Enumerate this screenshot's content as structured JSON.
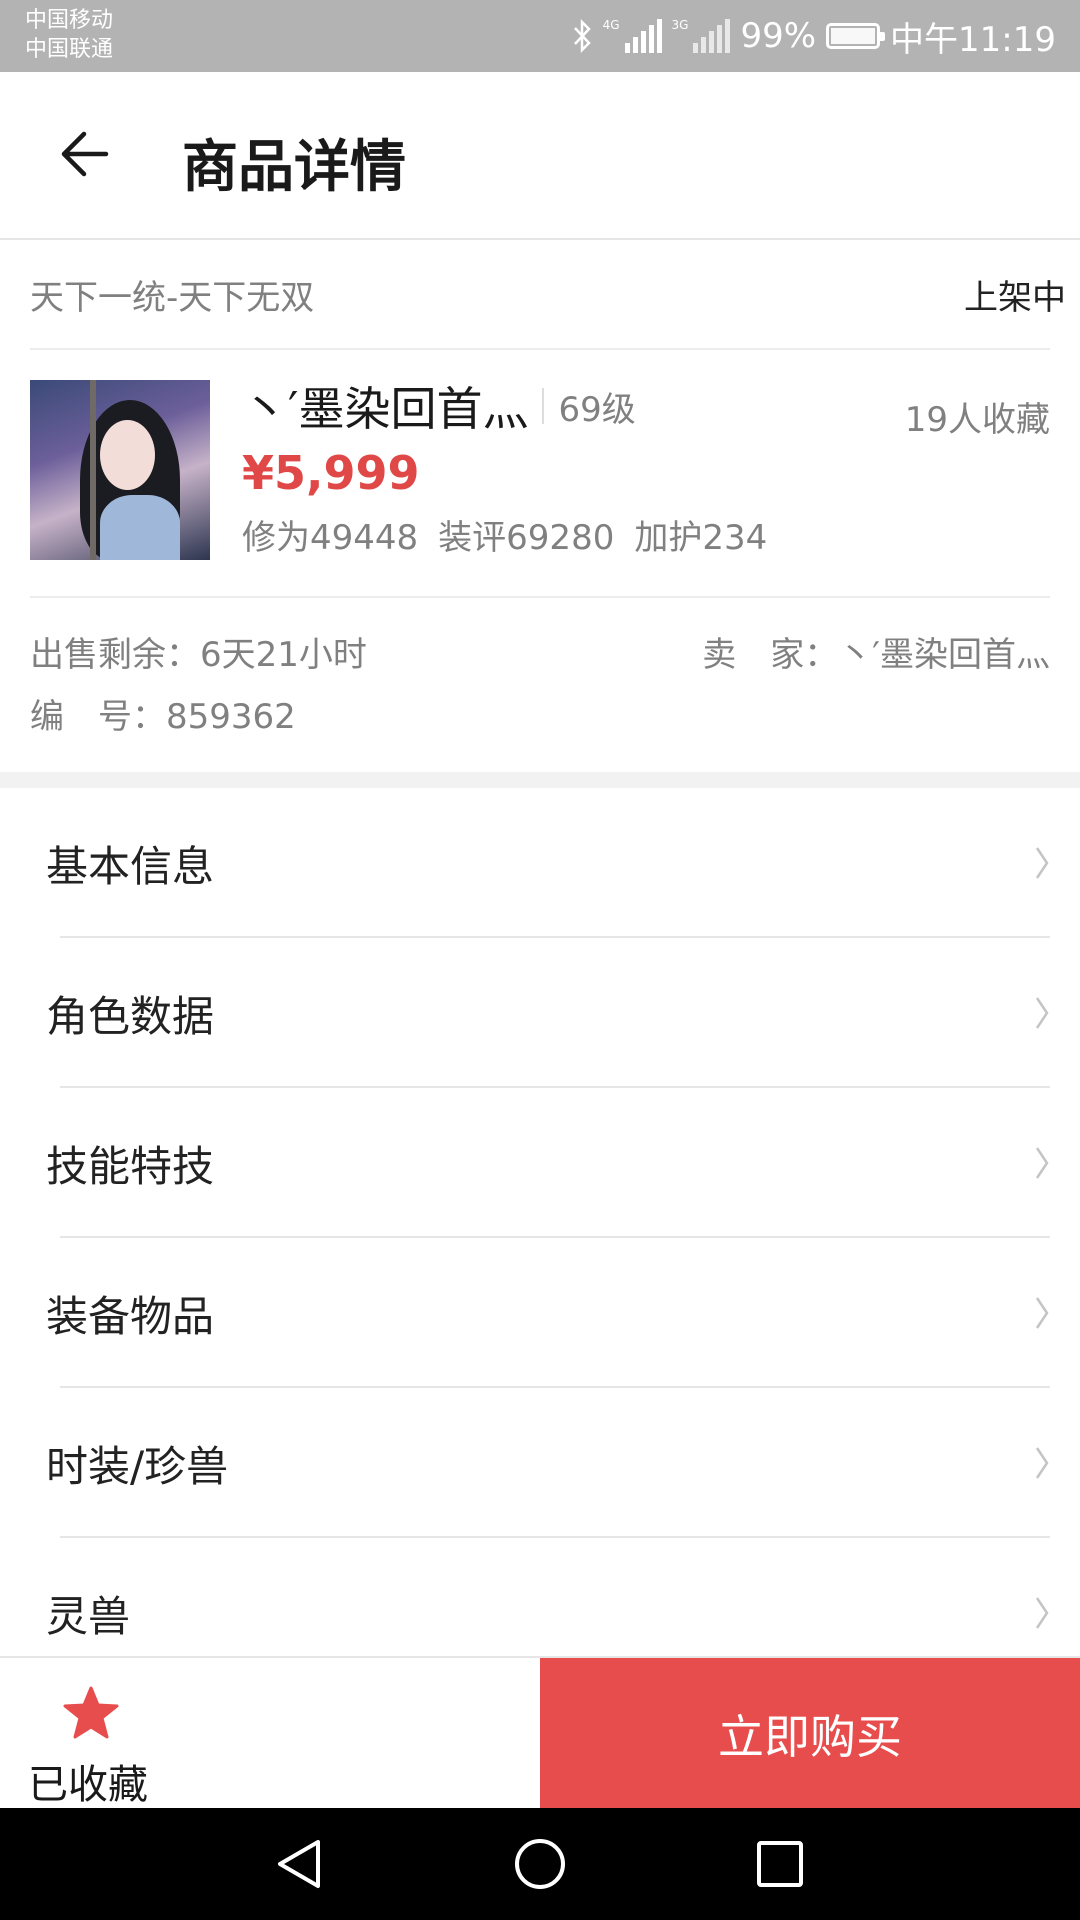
{
  "status_bar": {
    "carrier_1": "中国移动",
    "carrier_2": "中国联通",
    "network_1": "4G",
    "network_2": "3G",
    "battery": "99%",
    "battery_level": 0.99,
    "time": "中午11:19"
  },
  "header": {
    "title": "商品详情"
  },
  "product": {
    "server": "天下一统-天下无双",
    "status": "上架中",
    "name": "丶′墨染回首灬",
    "level": "69级",
    "favorites": "19人收藏",
    "price": "¥5,999",
    "stats": [
      "修为49448",
      "装评69280",
      "加护234"
    ],
    "time_left_label": "出售剩余：",
    "time_left": "6天21小时",
    "seller_label": "卖　家：",
    "seller": "丶′墨染回首灬",
    "id_label": "编　号：",
    "id": "859362"
  },
  "menu": {
    "items": [
      {
        "label": "基本信息"
      },
      {
        "label": "角色数据"
      },
      {
        "label": "技能特技"
      },
      {
        "label": "装备物品"
      },
      {
        "label": "时装/珍兽"
      },
      {
        "label": "灵兽"
      }
    ]
  },
  "actions": {
    "favorite_label": "已收藏",
    "buy_label": "立即购买",
    "accent_color": "#e84d4d"
  },
  "icons": {
    "back": "back-arrow-icon",
    "chevron": "chevron-right-icon",
    "star": "star-icon"
  }
}
